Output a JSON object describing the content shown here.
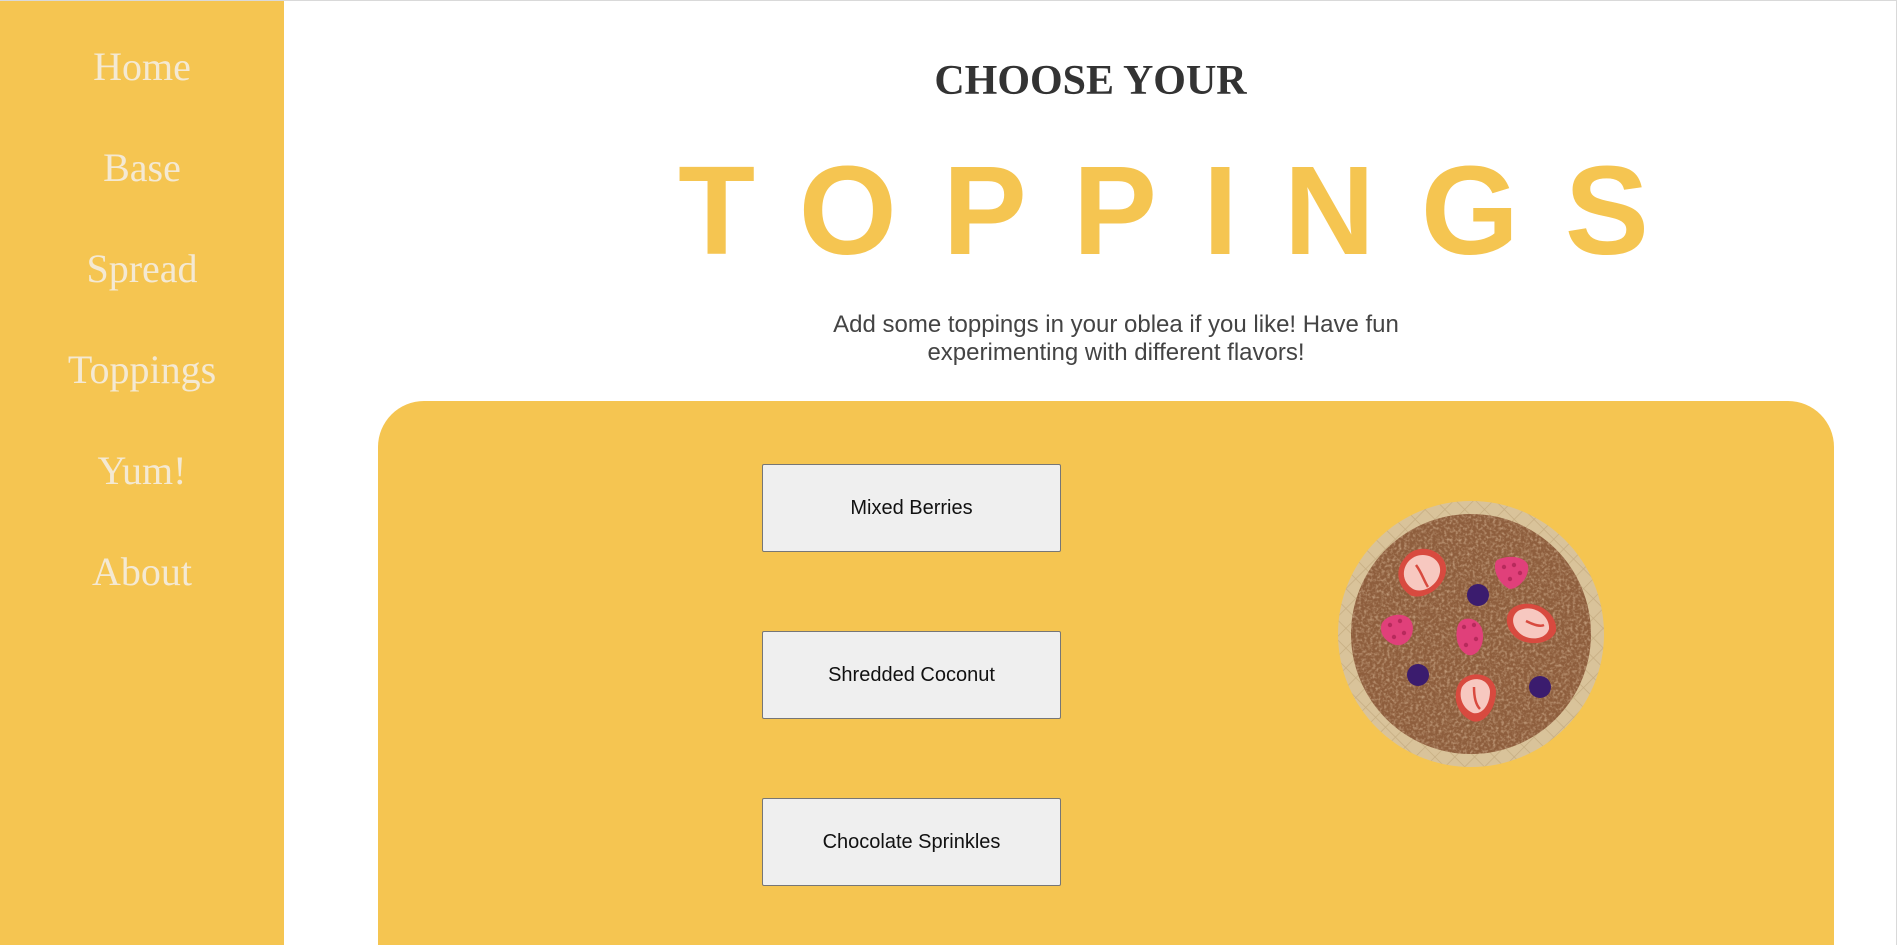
{
  "sidebar": {
    "items": [
      {
        "label": "Home"
      },
      {
        "label": "Base"
      },
      {
        "label": "Spread"
      },
      {
        "label": "Toppings"
      },
      {
        "label": "Yum!"
      },
      {
        "label": "About"
      }
    ]
  },
  "main": {
    "heading_small": "CHOOSE YOUR",
    "heading_large": "TOPPINGS",
    "description": "Add some toppings in your oblea if you like! Have fun experimenting with different flavors!",
    "toppings": [
      {
        "label": "Mixed Berries"
      },
      {
        "label": "Shredded Coconut"
      },
      {
        "label": "Chocolate Sprinkles"
      }
    ]
  },
  "colors": {
    "accent": "#F5C551",
    "nav_text": "#f4e9d3",
    "heading_dark": "#333333",
    "button_bg": "#efefef"
  }
}
